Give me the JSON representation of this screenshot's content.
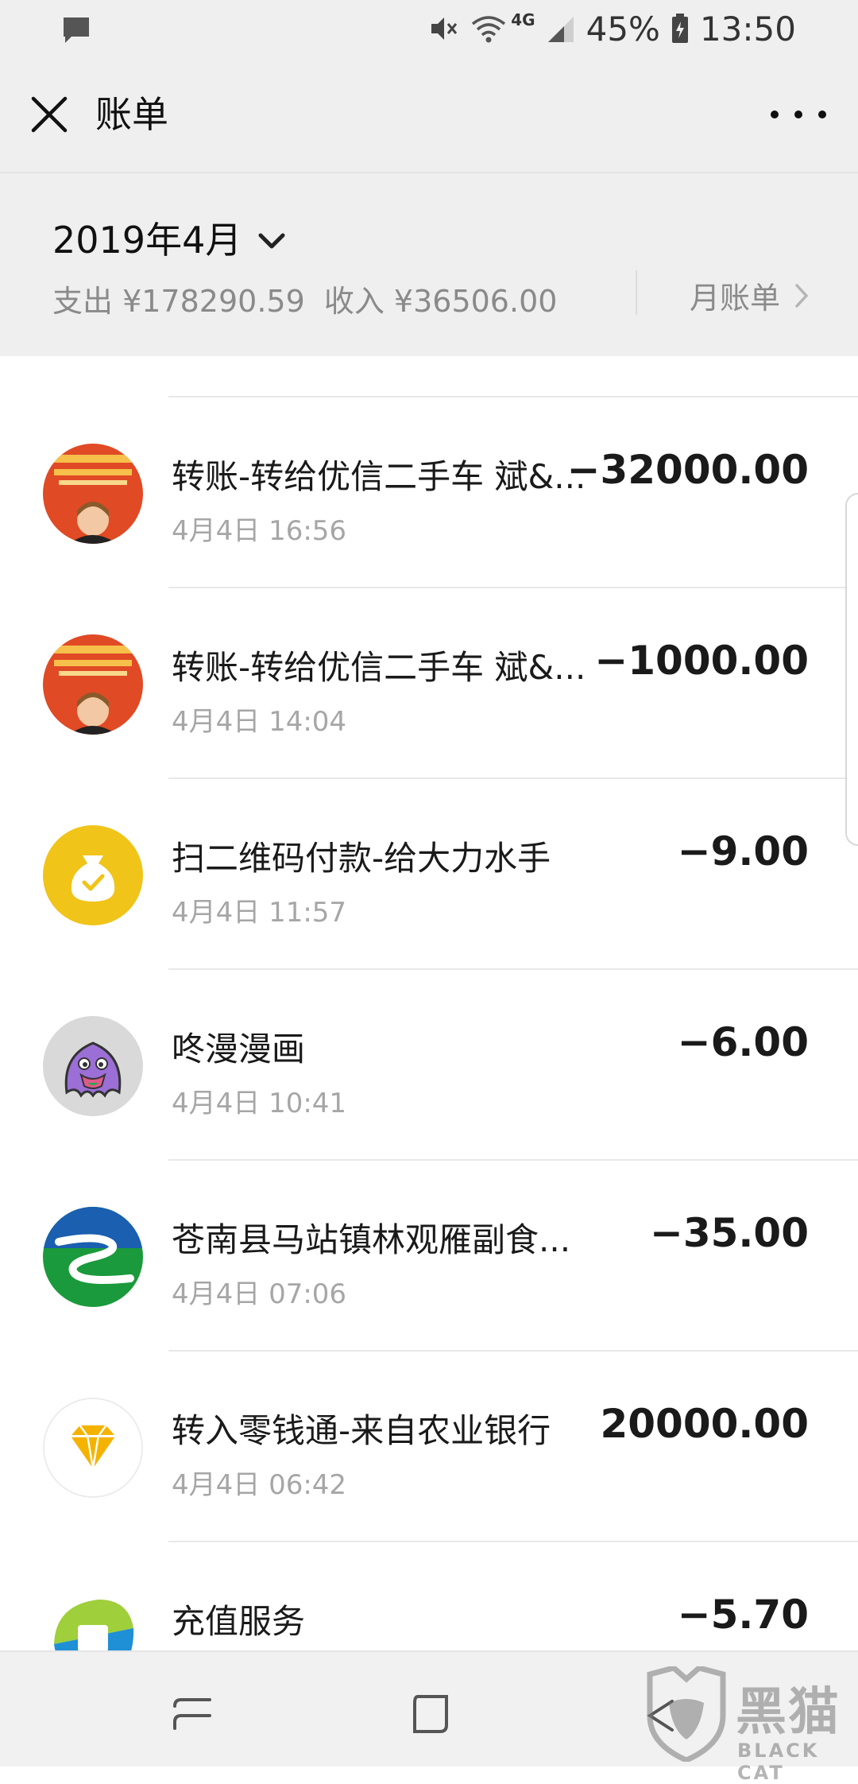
{
  "status_bar": {
    "battery": "45%",
    "time": "13:50",
    "network": "4G",
    "icons": [
      "message-icon",
      "mute-icon",
      "wifi-icon",
      "signal-icon",
      "battery-icon"
    ]
  },
  "header": {
    "title": "账单",
    "close_icon": "close-icon",
    "more_icon": "more-icon"
  },
  "summary": {
    "month": "2019年4月",
    "expense_label": "支出 ¥178290.59",
    "income_label": "收入 ¥36506.00",
    "monthly_bill": "月账单"
  },
  "transactions": [
    {
      "name": "转账-转给优信二手车 斌&...",
      "time": "4月4日 16:56",
      "amount": "−32000.00",
      "icon": "uxin-avatar"
    },
    {
      "name": "转账-转给优信二手车 斌&...",
      "time": "4月4日 14:04",
      "amount": "−1000.00",
      "icon": "uxin-avatar"
    },
    {
      "name": "扫二维码付款-给大力水手",
      "time": "4月4日 11:57",
      "amount": "−9.00",
      "icon": "money-bag-icon"
    },
    {
      "name": "咚漫漫画",
      "time": "4月4日 10:41",
      "amount": "−6.00",
      "icon": "dongman-icon"
    },
    {
      "name": "苍南县马站镇林观雁副食...",
      "time": "4月4日 07:06",
      "amount": "−35.00",
      "icon": "river-logo-icon"
    },
    {
      "name": "转入零钱通-来自农业银行",
      "time": "4月4日 06:42",
      "amount": "20000.00",
      "icon": "diamond-icon"
    },
    {
      "name": "充值服务",
      "time": "",
      "amount": "−5.70",
      "icon": "recharge-icon"
    }
  ],
  "watermark": {
    "text": "黑猫",
    "sub": "BLACK CAT"
  },
  "colors": {
    "background_gray": "#efefef",
    "secondary_text": "#8a8a8a",
    "time_text": "#a6a6a6",
    "avatar_red": "#e04a25",
    "yellow": "#f0c419",
    "green": "#1a9a3c",
    "blue": "#1a5fb0"
  }
}
